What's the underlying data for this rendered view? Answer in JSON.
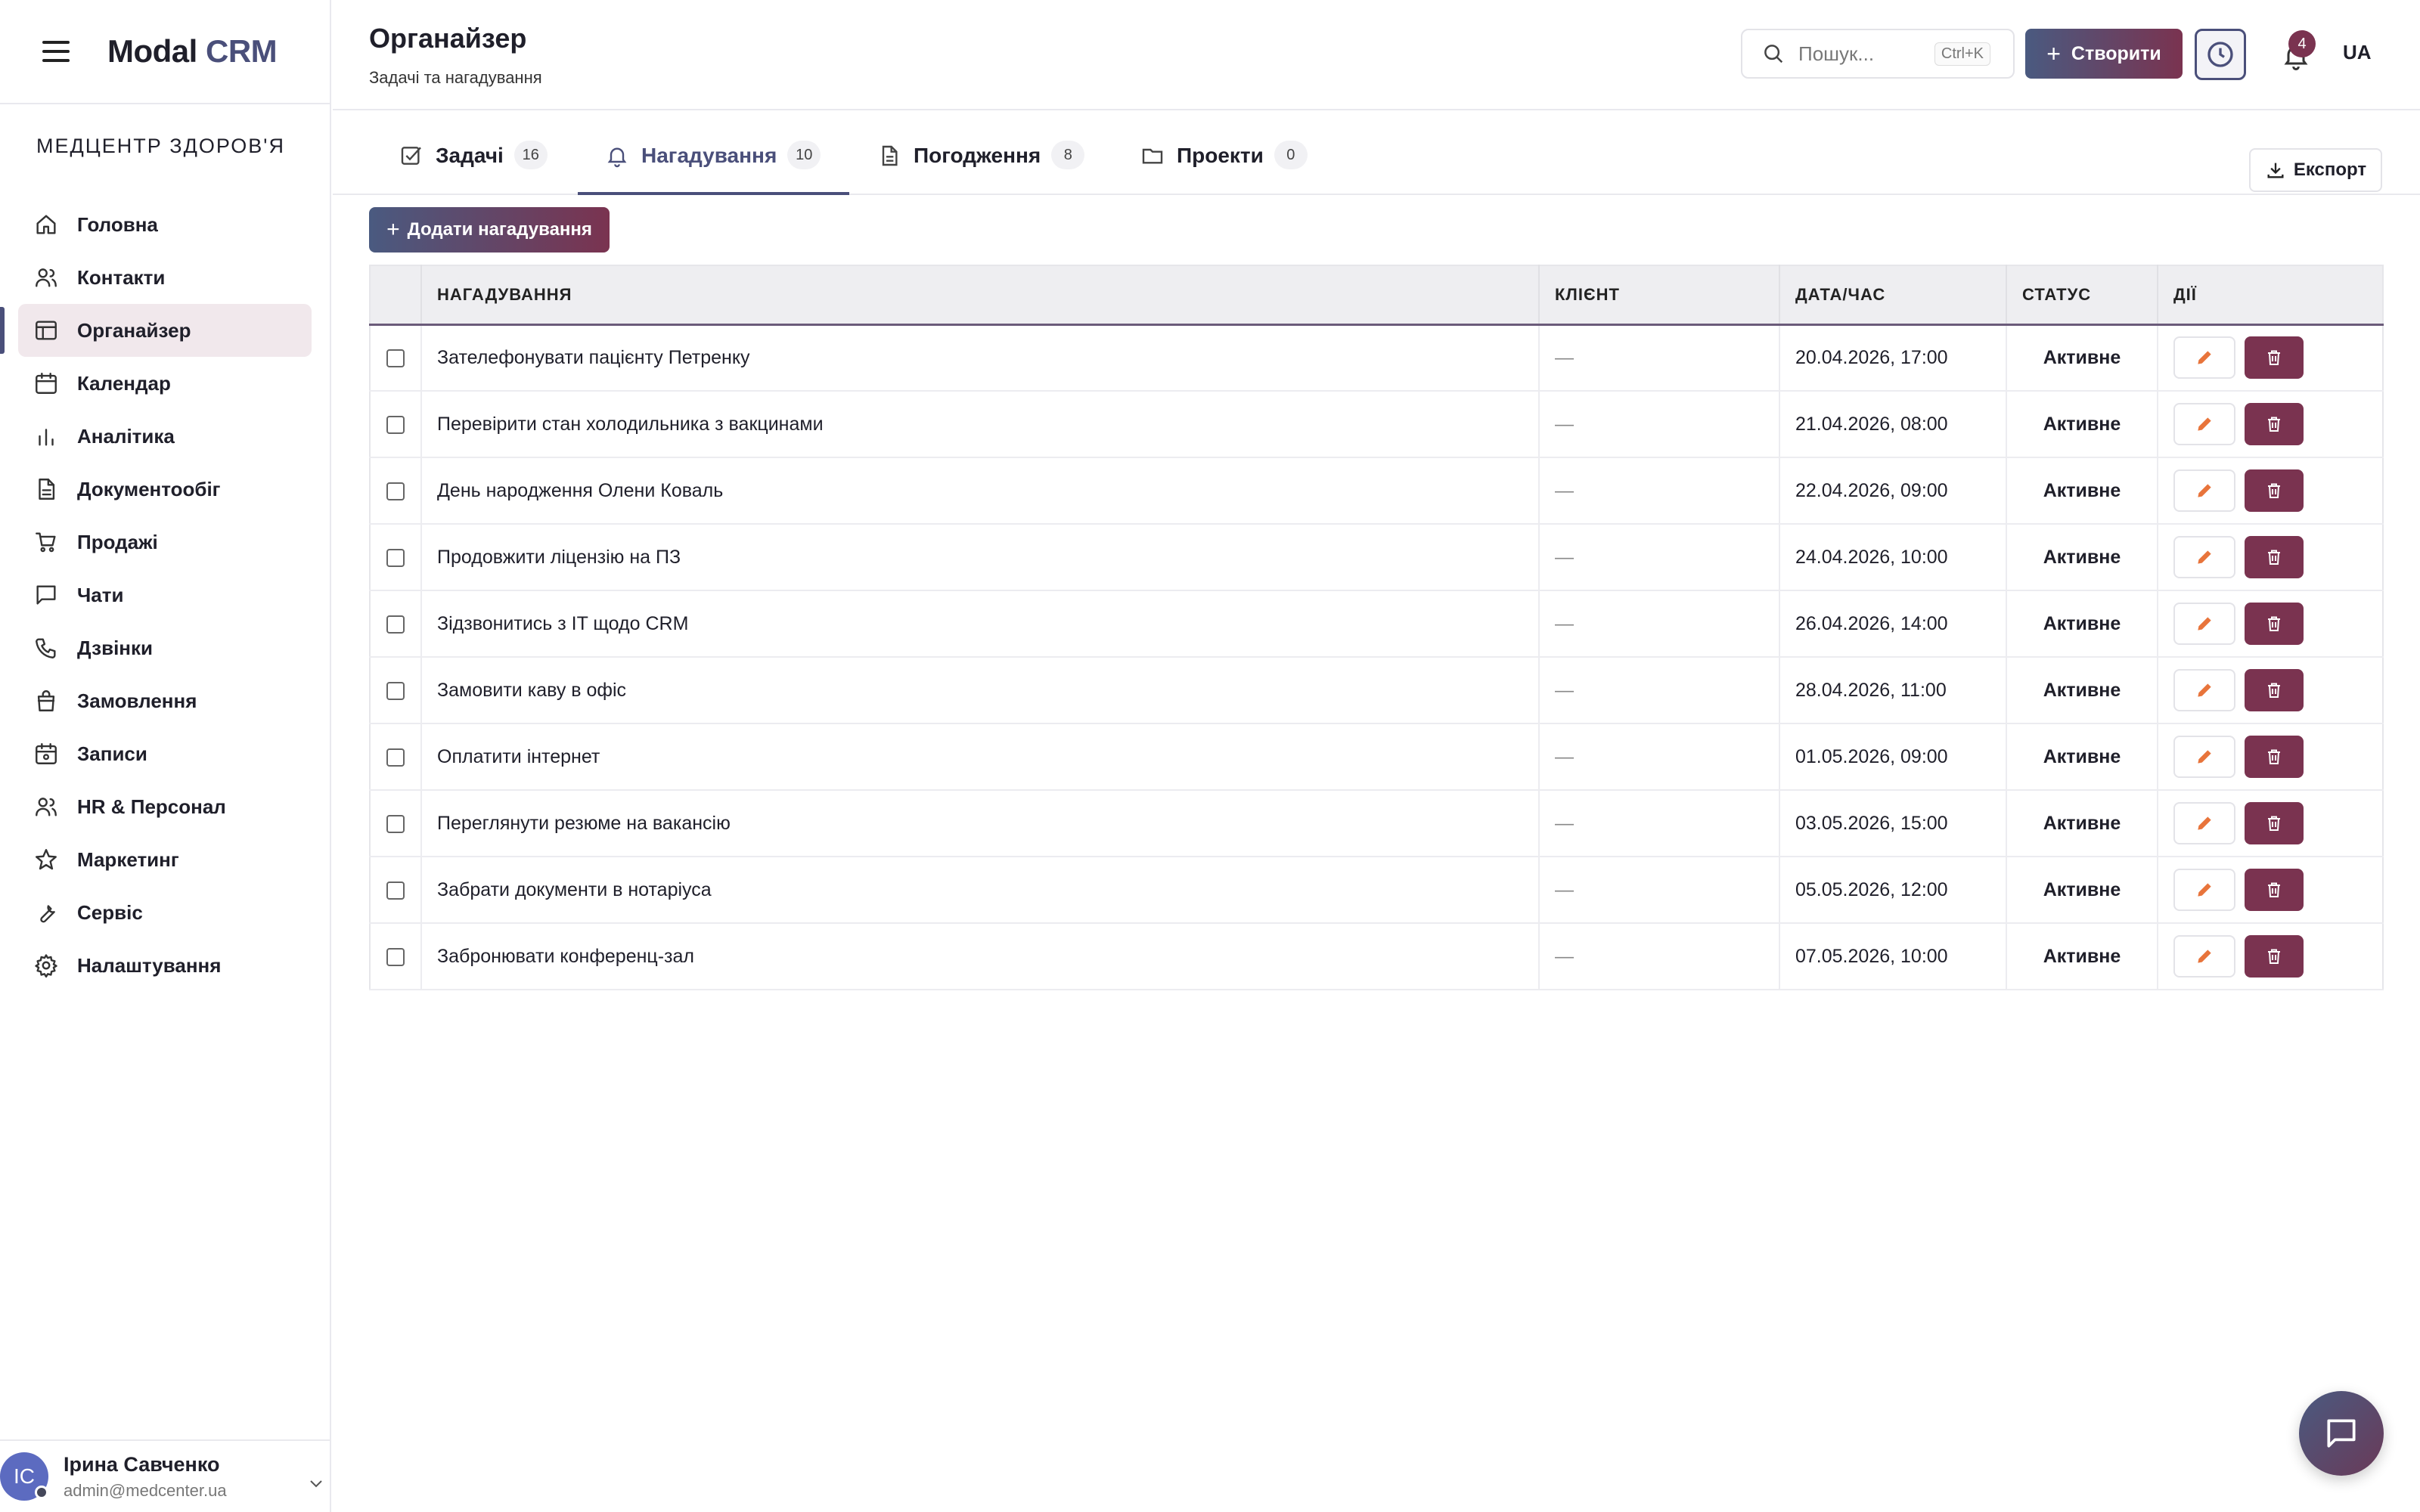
{
  "app": {
    "logo_main": "Modal",
    "logo_accent": "CRM"
  },
  "organization": "МЕДЦЕНТР ЗДОРОВ'Я",
  "sidebar": {
    "items": [
      {
        "label": "Головна",
        "icon": "home-icon"
      },
      {
        "label": "Контакти",
        "icon": "users-icon"
      },
      {
        "label": "Органайзер",
        "icon": "layout-icon",
        "active": true
      },
      {
        "label": "Календар",
        "icon": "calendar-icon"
      },
      {
        "label": "Аналітика",
        "icon": "bar-chart-icon"
      },
      {
        "label": "Документообіг",
        "icon": "document-icon"
      },
      {
        "label": "Продажі",
        "icon": "cart-icon"
      },
      {
        "label": "Чати",
        "icon": "chat-icon"
      },
      {
        "label": "Дзвінки",
        "icon": "phone-icon"
      },
      {
        "label": "Замовлення",
        "icon": "bag-icon"
      },
      {
        "label": "Записи",
        "icon": "calendar-check-icon"
      },
      {
        "label": "HR & Персонал",
        "icon": "people-icon"
      },
      {
        "label": "Маркетинг",
        "icon": "star-icon"
      },
      {
        "label": "Сервіс",
        "icon": "wrench-icon"
      },
      {
        "label": "Налаштування",
        "icon": "gear-icon"
      }
    ]
  },
  "user": {
    "initials": "IC",
    "name": "Ірина Савченко",
    "email": "admin@medcenter.ua"
  },
  "header": {
    "title": "Органайзер",
    "subtitle": "Задачі та нагадування",
    "search_placeholder": "Пошук...",
    "search_shortcut": "Ctrl+K",
    "create_label": "Створити",
    "notifications_count": "4",
    "language": "UA"
  },
  "tabs": [
    {
      "label": "Задачі",
      "count": "16",
      "icon": "checkbox-icon"
    },
    {
      "label": "Нагадування",
      "count": "10",
      "icon": "bell-icon",
      "active": true
    },
    {
      "label": "Погодження",
      "count": "8",
      "icon": "file-icon"
    },
    {
      "label": "Проекти",
      "count": "0",
      "icon": "folder-icon"
    }
  ],
  "export_label": "Експорт",
  "add_label": "Додати нагадування",
  "table": {
    "columns": [
      "НАГАДУВАННЯ",
      "КЛІЄНТ",
      "ДАТА/ЧАС",
      "СТАТУС",
      "ДІЇ"
    ],
    "rows": [
      {
        "title": "Зателефонувати пацієнту Петренку",
        "client": "—",
        "datetime": "20.04.2026, 17:00",
        "status": "Активне"
      },
      {
        "title": "Перевірити стан холодильника з вакцинами",
        "client": "—",
        "datetime": "21.04.2026, 08:00",
        "status": "Активне"
      },
      {
        "title": "День народження Олени Коваль",
        "client": "—",
        "datetime": "22.04.2026, 09:00",
        "status": "Активне"
      },
      {
        "title": "Продовжити ліцензію на ПЗ",
        "client": "—",
        "datetime": "24.04.2026, 10:00",
        "status": "Активне"
      },
      {
        "title": "Зідзвонитись з IT щодо CRM",
        "client": "—",
        "datetime": "26.04.2026, 14:00",
        "status": "Активне"
      },
      {
        "title": "Замовити каву в офіс",
        "client": "—",
        "datetime": "28.04.2026, 11:00",
        "status": "Активне"
      },
      {
        "title": "Оплатити інтернет",
        "client": "—",
        "datetime": "01.05.2026, 09:00",
        "status": "Активне"
      },
      {
        "title": "Переглянути резюме на вакансію",
        "client": "—",
        "datetime": "03.05.2026, 15:00",
        "status": "Активне"
      },
      {
        "title": "Забрати документи в нотаріуса",
        "client": "—",
        "datetime": "05.05.2026, 12:00",
        "status": "Активне"
      },
      {
        "title": "Забронювати конференц-зал",
        "client": "—",
        "datetime": "07.05.2026, 10:00",
        "status": "Активне"
      }
    ]
  },
  "colors": {
    "primary": "#4a4f7a",
    "accent": "#7a3350",
    "active_bg": "#f1e8ec",
    "edit_icon": "#e8743b"
  }
}
